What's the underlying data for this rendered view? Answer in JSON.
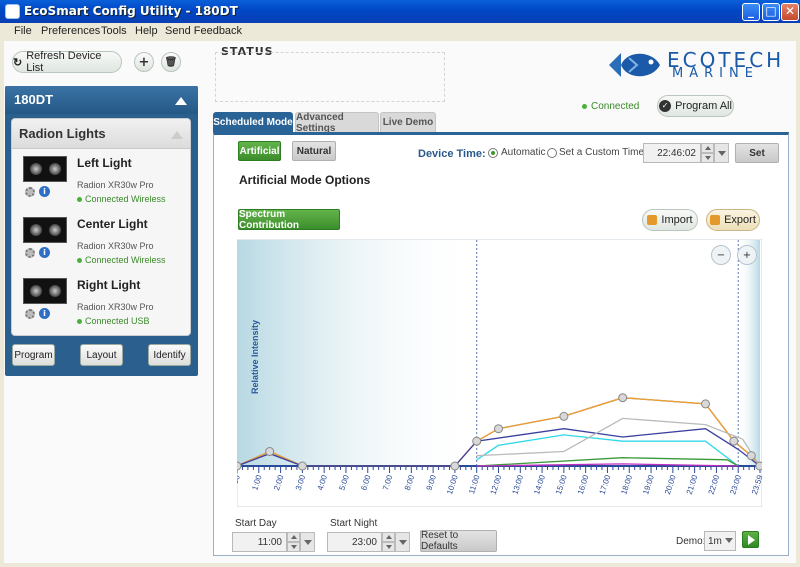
{
  "window": {
    "title": "EcoSmart Config Utility - 180DT",
    "min": "_",
    "max": "□",
    "close": "✕"
  },
  "menu": [
    "File",
    "Preferences",
    "Tools",
    "Help",
    "Send Feedback"
  ],
  "toolbar": {
    "refresh_label": "Refresh Device List",
    "add_label": "+",
    "delete_label": "🗑"
  },
  "device": {
    "name": "180DT",
    "group": "Radion Lights",
    "lights": [
      {
        "name": "Left Light",
        "model": "Radion XR30w Pro",
        "status": "Connected Wireless"
      },
      {
        "name": "Center Light",
        "model": "Radion XR30w Pro",
        "status": "Connected Wireless"
      },
      {
        "name": "Right Light",
        "model": "Radion XR30w Pro",
        "status": "Connected USB"
      }
    ],
    "buttons": {
      "program": "Program",
      "layout": "Layout",
      "identify": "Identify"
    }
  },
  "status": {
    "label": "STATUS"
  },
  "logo": {
    "top": "ECOTECH",
    "bottom": "MARINE"
  },
  "connection": {
    "status": "Connected",
    "program_all": "Program All"
  },
  "tabs": [
    {
      "label": "Scheduled Mode",
      "active": true
    },
    {
      "label": "Advanced Settings",
      "active": false
    },
    {
      "label": "Live Demo",
      "active": false
    }
  ],
  "mode": {
    "artificial": "Artificial",
    "natural": "Natural",
    "device_time_label": "Device Time:",
    "automatic": "Automatic",
    "custom_time": "Set a Custom Time:",
    "time_value": "22:46:02",
    "set_label": "Set",
    "section_title": "Artificial Mode Options",
    "spectrum_btn": "Spectrum Contribution",
    "import_label": "Import",
    "export_label": "Export",
    "zoom_out": "−",
    "zoom_in": "+"
  },
  "schedule": {
    "start_day_label": "Start Day",
    "start_day": "11:00",
    "start_night_label": "Start Night",
    "start_night": "23:00",
    "reset_label": "Reset to Defaults",
    "demo_label": "Demo:",
    "demo_value": "1m"
  },
  "chart_data": {
    "type": "line",
    "ylabel": "Relative Intensity",
    "xlabel": "",
    "ylim": [
      0,
      100
    ],
    "x_ticks": [
      "0:00",
      "1:00",
      "2:00",
      "3:00",
      "4:00",
      "5:00",
      "6:00",
      "7:00",
      "8:00",
      "9:00",
      "10:00",
      "11:00",
      "12:00",
      "13:00",
      "14:00",
      "15:00",
      "16:00",
      "17:00",
      "18:00",
      "19:00",
      "20:00",
      "21:00",
      "22:00",
      "23:00",
      "23:59"
    ],
    "series": [
      {
        "color": "#666666",
        "points": [
          [
            0,
            0
          ],
          [
            1.5,
            7
          ],
          [
            3,
            0
          ],
          [
            10,
            0
          ],
          [
            11,
            12
          ],
          [
            12,
            18
          ],
          [
            15,
            24
          ],
          [
            17.7,
            33
          ],
          [
            21.5,
            30
          ],
          [
            22.8,
            12
          ],
          [
            23.6,
            5
          ],
          [
            23.99,
            0
          ]
        ]
      },
      {
        "color": "#f0a030",
        "points": [
          [
            0,
            0
          ],
          [
            1.5,
            7
          ],
          [
            3,
            0
          ],
          [
            10,
            0
          ],
          [
            11,
            12
          ],
          [
            12,
            18
          ],
          [
            15,
            24
          ],
          [
            17.7,
            33
          ],
          [
            21.5,
            30
          ],
          [
            22.8,
            12
          ],
          [
            23.6,
            5
          ],
          [
            23.99,
            0
          ]
        ]
      },
      {
        "color": "#3b3fa0",
        "points": [
          [
            0,
            0
          ],
          [
            1.5,
            6
          ],
          [
            3,
            0
          ],
          [
            10,
            0
          ],
          [
            11,
            12
          ],
          [
            15,
            18
          ],
          [
            17.7,
            14
          ],
          [
            21.5,
            18
          ],
          [
            23,
            8
          ],
          [
            23.99,
            0
          ]
        ]
      },
      {
        "color": "#30d8e8",
        "points": [
          [
            11,
            3
          ],
          [
            12,
            10
          ],
          [
            15,
            15
          ],
          [
            17.7,
            12
          ],
          [
            21.5,
            12
          ],
          [
            23,
            0
          ]
        ]
      },
      {
        "color": "#bbbbbb",
        "points": [
          [
            11,
            5
          ],
          [
            15,
            7
          ],
          [
            17.7,
            23
          ],
          [
            21.5,
            20
          ],
          [
            23.2,
            13
          ],
          [
            23.99,
            0
          ]
        ]
      },
      {
        "color": "#3a9a3a",
        "points": [
          [
            11,
            0
          ],
          [
            17.7,
            4
          ],
          [
            22.5,
            3
          ],
          [
            23,
            0
          ]
        ]
      },
      {
        "color": "#c030c0",
        "points": [
          [
            11,
            0
          ],
          [
            17.7,
            1
          ],
          [
            23,
            0
          ]
        ]
      }
    ],
    "handles": [
      [
        0,
        0
      ],
      [
        1.5,
        7
      ],
      [
        3,
        0
      ],
      [
        10,
        0
      ],
      [
        11,
        12
      ],
      [
        12,
        18
      ],
      [
        15,
        24
      ],
      [
        17.7,
        33
      ],
      [
        21.5,
        30
      ],
      [
        22.8,
        12
      ],
      [
        23.6,
        5
      ],
      [
        23.99,
        0
      ]
    ],
    "day_start": 11,
    "night_start": 23
  }
}
